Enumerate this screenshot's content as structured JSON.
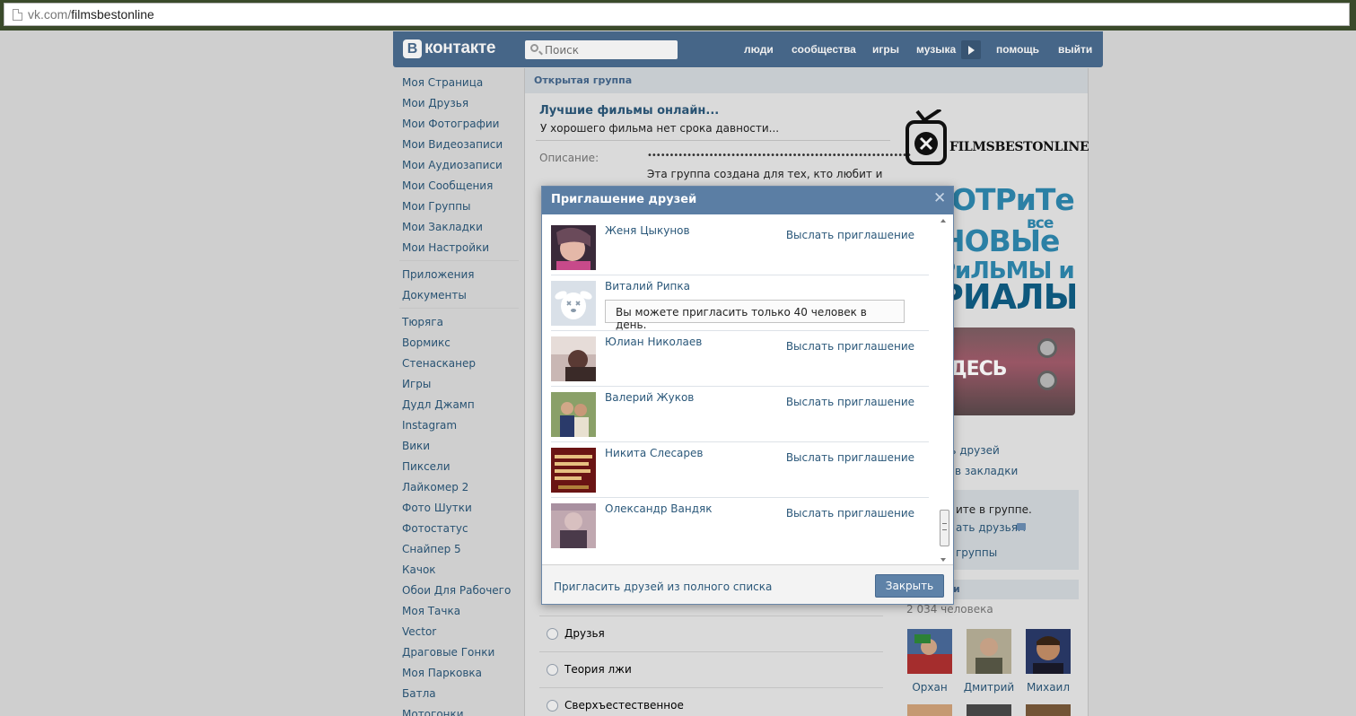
{
  "browser": {
    "url_domain": "vk.com/",
    "url_path": "filmsbestonline"
  },
  "header": {
    "logo_letter": "В",
    "logo_text": "контакте",
    "search_placeholder": "Поиск",
    "nav": [
      "люди",
      "сообщества",
      "игры",
      "музыка",
      "помощь",
      "выйти"
    ]
  },
  "left_menu": {
    "main": [
      "Моя Страница",
      "Мои Друзья",
      "Мои Фотографии",
      "Мои Видеозаписи",
      "Мои Аудиозаписи",
      "Мои Сообщения",
      "Мои Группы",
      "Мои Закладки",
      "Мои Настройки"
    ],
    "tools": [
      "Приложения",
      "Документы"
    ],
    "apps": [
      "Тюряга",
      "Вормикс",
      "Стенасканер",
      "Игры",
      "Дудл Джамп",
      "Instagram",
      "Вики",
      "Пиксели",
      "Лайкомер 2",
      "Фото Шутки",
      "Фотостатус",
      "Снайпер 5",
      "Качок",
      "Обои Для Рабочего",
      "Моя Тачка",
      "Vector",
      "Драговые Гонки",
      "Моя Парковка",
      "Батла",
      "Мотогонки"
    ]
  },
  "group": {
    "bar_title": "Открытая группа",
    "name": "Лучшие фильмы онлайн...",
    "status": "У хорошего фильма нет срока давности...",
    "desc_label": "Описание:",
    "desc_dots": "••••••••••••••••••••••••••••••••••••••••••••••••••••••••••••",
    "desc_text": "Эта группа создана для тех, кто любит и",
    "poll_options": [
      "Друзья",
      "Теория лжи",
      "Сверхъестественное"
    ]
  },
  "right": {
    "logo_text": "FILMSBESTONLINE",
    "poster_lines": [
      "ОТРиТе",
      "все",
      "НОВЫе",
      "РиЛЬМЫ и",
      "РИАЛЫ",
      "ДЕСЬ"
    ],
    "links": [
      "ать друзей",
      "в закладки"
    ],
    "box_text": "ите в группе.",
    "box_link1": "ать друзьям",
    "box_link2": "группы",
    "members_bar": "и",
    "members_count": "2 034 человека",
    "members": [
      "Орхан",
      "Дмитрий",
      "Михаил"
    ]
  },
  "dialog": {
    "title": "Приглашение друзей",
    "close_symbol": "✕",
    "invite_label": "Выслать приглашение",
    "limit_warning": "Вы можете пригласить только 40 человек в день.",
    "friends": [
      {
        "name": "Женя Цыкунов"
      },
      {
        "name": "Виталий Рипка"
      },
      {
        "name": "Юлиан Николаев"
      },
      {
        "name": "Валерий Жуков"
      },
      {
        "name": "Никита Слесарев"
      },
      {
        "name": "Олександр Вандяк"
      }
    ],
    "full_list_link": "Пригласить друзей из полного списка",
    "close_button": "Закрыть"
  },
  "colors": {
    "brand": "#4b6d91",
    "link": "#2b587a",
    "dialog_head": "#5b7ea4",
    "button": "#5e82a8"
  }
}
